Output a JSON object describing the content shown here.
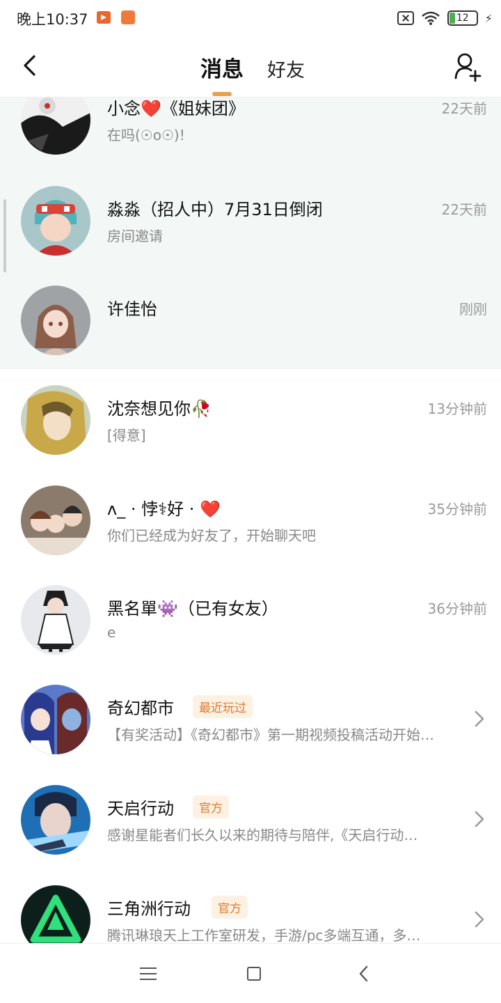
{
  "status_bar": {
    "time": "晚上10:37",
    "battery": "12"
  },
  "header": {
    "tab_messages": "消息",
    "tab_friends": "好友"
  },
  "rows": [
    {
      "name": "小念❤️《姐妹团》",
      "preview": "在吗(☉o☉)!",
      "time": "22天前"
    },
    {
      "name": "淼淼（招人中）7月31日倒闭",
      "preview": "房间邀请",
      "time": "22天前"
    },
    {
      "name": "许佳怡",
      "preview": "",
      "time": "刚刚"
    },
    {
      "name": "沈奈想见你🥀",
      "preview": "[得意]",
      "time": "13分钟前"
    },
    {
      "name": "ʌ_ · 悖⚕好 · ❤️",
      "preview": "你们已经成为好友了，开始聊天吧",
      "time": "35分钟前"
    },
    {
      "name": "黑名單👾（已有女友）",
      "preview": "e",
      "time": "36分钟前"
    },
    {
      "name": "奇幻都市",
      "badge": "最近玩过",
      "preview": "【有奖活动】《奇幻都市》第一期视频投稿活动开始…"
    },
    {
      "name": "天启行动",
      "badge": "官方",
      "preview": "感谢星能者们长久以来的期待与陪伴,《天启行动…"
    },
    {
      "name": "三角洲行动",
      "badge": "官方",
      "preview": "腾讯琳琅天上工作室研发，手游/pc多端互通，多…"
    }
  ]
}
